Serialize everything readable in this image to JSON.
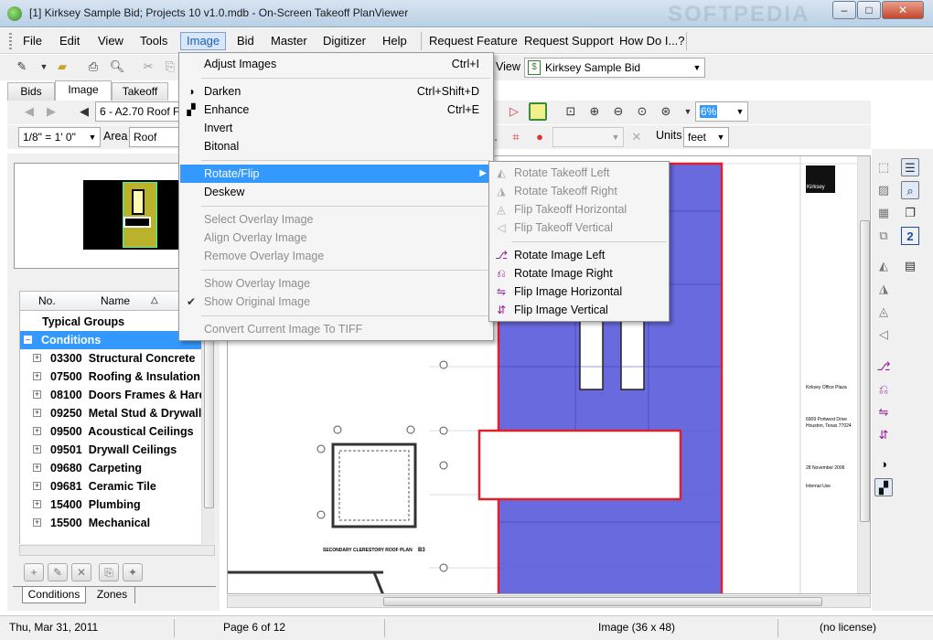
{
  "window": {
    "title": "[1] Kirksey Sample Bid; Projects 10 v1.0.mdb - On-Screen Takeoff PlanViewer",
    "watermark": "SOFTPEDIA",
    "minimize": "–",
    "maximize": "□",
    "close": "✕"
  },
  "menubar": {
    "items": [
      "File",
      "Edit",
      "View",
      "Tools",
      "Image",
      "Bid",
      "Master",
      "Digitizer",
      "Help",
      "Request Feature",
      "Request Support",
      "How Do I...?"
    ],
    "active": "Image"
  },
  "toolbar": {
    "view_label": "View",
    "bid_combo": "Kirksey Sample Bid",
    "page_combo": "6 - A2.70 Roof F",
    "scale_combo": "1/8\" = 1' 0\"",
    "area_label": "Area",
    "area_combo": "Roof",
    "zoom_combo": "6%",
    "units_label": "Units",
    "units_combo": "feet"
  },
  "tabs": [
    "Bids",
    "Image",
    "Takeoff"
  ],
  "selected_tab": "Image",
  "conditions_grid": {
    "col_no": "No.",
    "col_name": "Name",
    "rows": [
      {
        "label": "Typical Groups",
        "type": "group"
      },
      {
        "label": "Conditions",
        "type": "selected"
      },
      {
        "label": "03300  Structural Concrete"
      },
      {
        "label": "07500  Roofing & Insulation"
      },
      {
        "label": "08100  Doors Frames & Hard"
      },
      {
        "label": "09250  Metal Stud & Drywall"
      },
      {
        "label": "09500  Acoustical Ceilings"
      },
      {
        "label": "09501  Drywall Ceilings"
      },
      {
        "label": "09680  Carpeting"
      },
      {
        "label": "09681  Ceramic Tile"
      },
      {
        "label": "15400  Plumbing"
      },
      {
        "label": "15500  Mechanical"
      }
    ]
  },
  "bottom_tabs": [
    "Conditions",
    "Zones"
  ],
  "image_menu": {
    "items": [
      {
        "label": "Adjust Images",
        "shortcut": "Ctrl+I"
      },
      {
        "label": "Darken",
        "shortcut": "Ctrl+Shift+D",
        "icon": "◑"
      },
      {
        "label": "Enhance",
        "shortcut": "Ctrl+E",
        "icon": "▞"
      },
      {
        "label": "Invert",
        "shortcut": ""
      },
      {
        "label": "Bitonal",
        "shortcut": ""
      },
      {
        "label": "Rotate/Flip",
        "shortcut": "▶"
      },
      {
        "label": "Deskew",
        "shortcut": ""
      },
      {
        "label": "Select Overlay Image",
        "shortcut": ""
      },
      {
        "label": "Align Overlay Image",
        "shortcut": ""
      },
      {
        "label": "Remove Overlay Image",
        "shortcut": ""
      },
      {
        "label": "Show Overlay Image",
        "shortcut": ""
      },
      {
        "label": "Show Original Image",
        "shortcut": "",
        "check": "✔"
      },
      {
        "label": "Convert Current Image To TIFF",
        "shortcut": ""
      }
    ]
  },
  "rotate_submenu": {
    "items": [
      "Rotate Takeoff Left",
      "Rotate Takeoff Right",
      "Flip Takeoff Horizontal",
      "Flip Takeoff Vertical",
      "Rotate Image Left",
      "Rotate Image Right",
      "Flip Image Horizontal",
      "Flip Image Vertical"
    ]
  },
  "drawing": {
    "logo": "Kirksey",
    "plan_title": "SECONDARY CLERESTORY ROOF PLAN",
    "plan_tag": "B3",
    "project_name": "Kirksey Office Plaza",
    "address1": "6909 Portwest Drive",
    "address2": "Houston, Texas 77024",
    "date": "28 November 2006",
    "use": "Internal Use"
  },
  "status": {
    "date": "Thu, Mar 31, 2011",
    "page": "Page 6 of 12",
    "image": "Image (36 x 48)",
    "license": "(no license)"
  },
  "colors": {
    "accent": "#3399ff",
    "takeoff_fill": "#5a5adc",
    "takeoff_border": "#e0202a"
  }
}
